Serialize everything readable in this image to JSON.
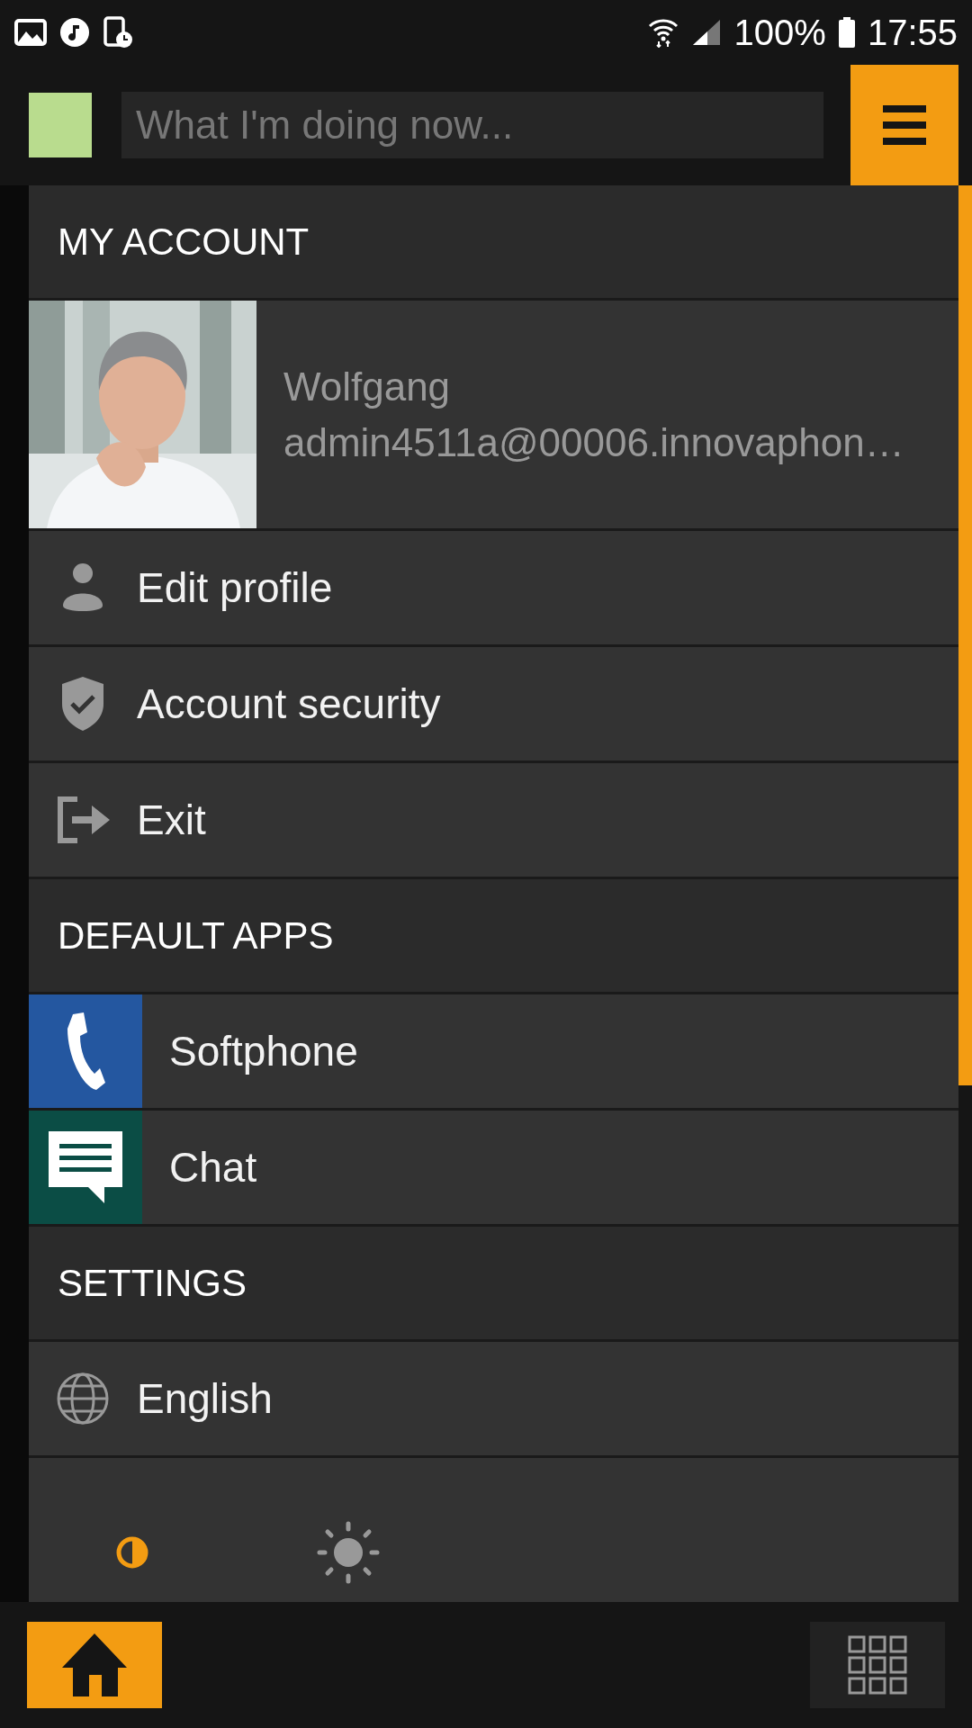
{
  "status_bar": {
    "battery": "100%",
    "time": "17:55"
  },
  "top_bar": {
    "status_field": {
      "placeholder": "What I'm doing now..."
    }
  },
  "menu": {
    "sections": [
      {
        "title": "MY ACCOUNT",
        "profile": {
          "name": "Wolfgang",
          "address": "admin4511a@00006.innovaphon…"
        },
        "items": [
          {
            "kind": "person",
            "label": "Edit profile"
          },
          {
            "kind": "shield",
            "label": "Account security"
          },
          {
            "kind": "exit",
            "label": "Exit"
          }
        ]
      },
      {
        "title": "DEFAULT APPS",
        "items": [
          {
            "kind": "phone",
            "label": "Softphone",
            "color": "#2457a0"
          },
          {
            "kind": "chat",
            "label": "Chat",
            "color": "#0b4d45"
          }
        ]
      },
      {
        "title": "SETTINGS",
        "items": [
          {
            "kind": "globe",
            "label": "English"
          }
        ]
      }
    ],
    "theme_options": [
      {
        "kind": "dark",
        "selected": true
      },
      {
        "kind": "light",
        "selected": false
      }
    ]
  }
}
